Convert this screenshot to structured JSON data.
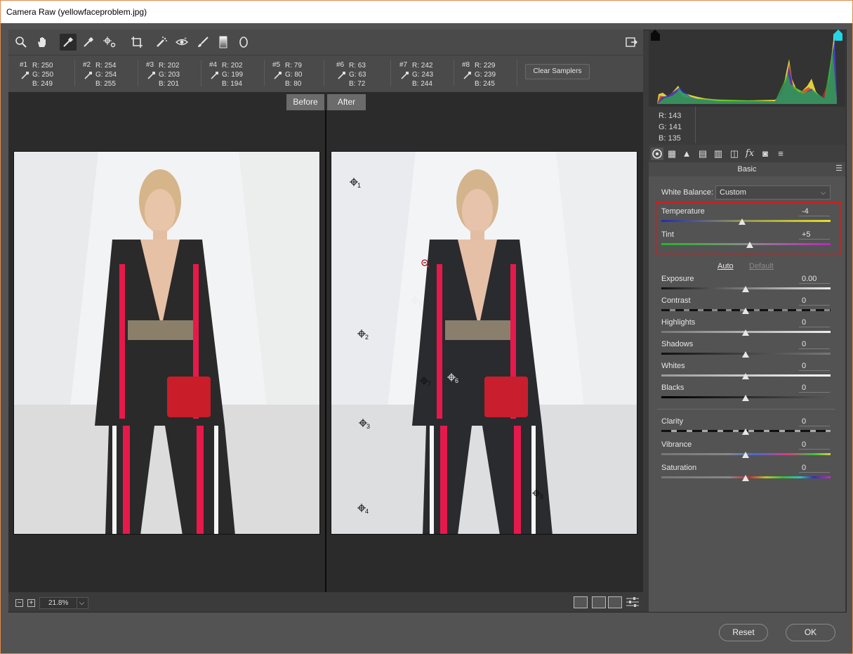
{
  "window": {
    "title": "Camera Raw (yellowfaceproblem.jpg)"
  },
  "toolbar": {
    "tools": [
      "zoom-icon",
      "hand-icon",
      "white-balance-icon",
      "color-sampler-icon",
      "target-adjust-icon",
      "crop-icon",
      "spot-removal-icon",
      "red-eye-icon",
      "adjustment-brush-icon",
      "graduated-filter-icon",
      "radial-filter-icon"
    ],
    "open_preferences_icon": "preferences-icon"
  },
  "samplers": [
    {
      "id": "#1",
      "r": "R: 250",
      "g": "G: 250",
      "b": "B: 249"
    },
    {
      "id": "#2",
      "r": "R: 254",
      "g": "G: 254",
      "b": "B: 255"
    },
    {
      "id": "#3",
      "r": "R: 202",
      "g": "G: 203",
      "b": "B: 201"
    },
    {
      "id": "#4",
      "r": "R: 202",
      "g": "G: 199",
      "b": "B: 194"
    },
    {
      "id": "#5",
      "r": "R: 79",
      "g": "G: 80",
      "b": "B: 80"
    },
    {
      "id": "#6",
      "r": "R: 63",
      "g": "G: 63",
      "b": "B: 72"
    },
    {
      "id": "#7",
      "r": "R: 242",
      "g": "G: 243",
      "b": "B: 244"
    },
    {
      "id": "#8",
      "r": "R: 229",
      "g": "G: 239",
      "b": "B: 245"
    }
  ],
  "clear_samplers": "Clear Samplers",
  "view": {
    "before": "Before",
    "after": "After"
  },
  "markers": [
    "1",
    "2",
    "3",
    "4",
    "5",
    "6",
    "7",
    "8"
  ],
  "zoom": {
    "value": "21.8%",
    "minus": "−",
    "plus": "+"
  },
  "histogram": {
    "r": "R:  143",
    "g": "G:  141",
    "b": "B:  135"
  },
  "panel": {
    "title": "Basic",
    "white_balance_label": "White Balance:",
    "white_balance_value": "Custom",
    "auto": "Auto",
    "default": "Default"
  },
  "sliders": {
    "temperature": {
      "label": "Temperature",
      "value": "-4"
    },
    "tint": {
      "label": "Tint",
      "value": "+5"
    },
    "exposure": {
      "label": "Exposure",
      "value": "0.00"
    },
    "contrast": {
      "label": "Contrast",
      "value": "0"
    },
    "highlights": {
      "label": "Highlights",
      "value": "0"
    },
    "shadows": {
      "label": "Shadows",
      "value": "0"
    },
    "whites": {
      "label": "Whites",
      "value": "0"
    },
    "blacks": {
      "label": "Blacks",
      "value": "0"
    },
    "clarity": {
      "label": "Clarity",
      "value": "0"
    },
    "vibrance": {
      "label": "Vibrance",
      "value": "0"
    },
    "saturation": {
      "label": "Saturation",
      "value": "0"
    }
  },
  "buttons": {
    "reset": "Reset",
    "ok": "OK"
  },
  "colors": {
    "accent_red": "#cc1f1f",
    "panel_bg": "#535353",
    "canvas_bg": "#2b2b2b"
  }
}
